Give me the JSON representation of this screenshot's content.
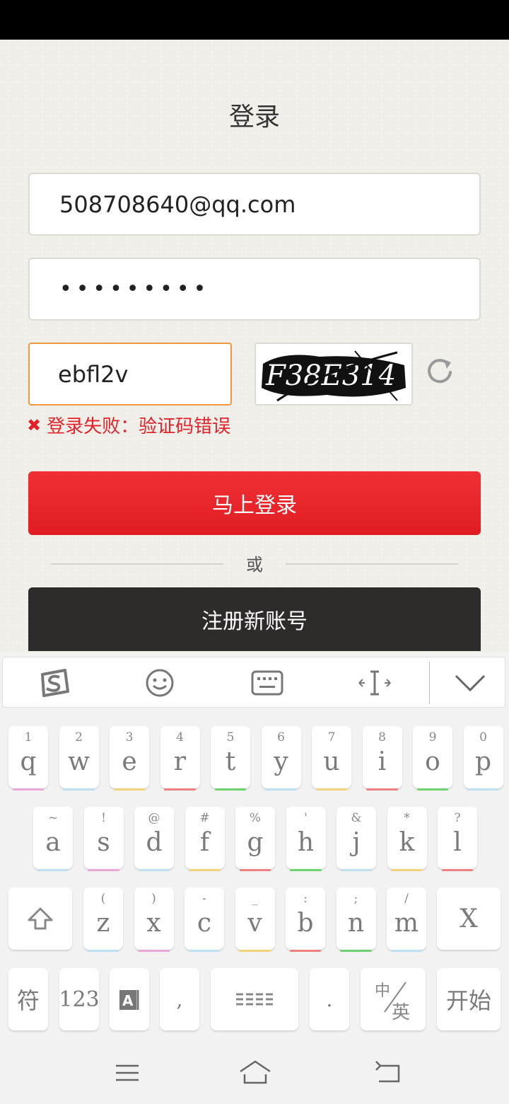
{
  "page": {
    "title": "登录"
  },
  "form": {
    "email_value": "508708640@qq.com",
    "password_value": "•••••••••",
    "captcha_value": "ebfl2v",
    "captcha_image_text": "F38E314",
    "error_text": "登录失败：验证码错误",
    "login_label": "马上登录",
    "or_label": "或",
    "register_label": "注册新账号"
  },
  "keyboard": {
    "row1": [
      {
        "k": "q",
        "s": "1",
        "c": "#e9a7d8"
      },
      {
        "k": "w",
        "s": "2",
        "c": "#bfe0f0"
      },
      {
        "k": "e",
        "s": "3",
        "c": "#f3d27a"
      },
      {
        "k": "r",
        "s": "4",
        "c": "#f07f7f"
      },
      {
        "k": "t",
        "s": "5",
        "c": "#6ed36e"
      },
      {
        "k": "y",
        "s": "6",
        "c": "#bfe0f0"
      },
      {
        "k": "u",
        "s": "7",
        "c": "#f3d27a"
      },
      {
        "k": "i",
        "s": "8",
        "c": "#f07f7f"
      },
      {
        "k": "o",
        "s": "9",
        "c": "#6ed36e"
      },
      {
        "k": "p",
        "s": "0",
        "c": "#bfe0f0"
      }
    ],
    "row2": [
      {
        "k": "a",
        "s": "~",
        "c": "#bfe0f0"
      },
      {
        "k": "s",
        "s": "!",
        "c": "#e9a7d8"
      },
      {
        "k": "d",
        "s": "@",
        "c": "#bfe0f0"
      },
      {
        "k": "f",
        "s": "#",
        "c": "#f3d27a"
      },
      {
        "k": "g",
        "s": "%",
        "c": "#f07f7f"
      },
      {
        "k": "h",
        "s": "'",
        "c": "#6ed36e"
      },
      {
        "k": "j",
        "s": "&",
        "c": "#bfe0f0"
      },
      {
        "k": "k",
        "s": "*",
        "c": "#f3d27a"
      },
      {
        "k": "l",
        "s": "?",
        "c": "#f07f7f"
      }
    ],
    "row3": [
      {
        "k": "z",
        "s": "(",
        "c": "#bfe0f0"
      },
      {
        "k": "x",
        "s": ")",
        "c": "#e9a7d8"
      },
      {
        "k": "c",
        "s": "-",
        "c": "#bfe0f0"
      },
      {
        "k": "v",
        "s": "_",
        "c": "#f3d27a"
      },
      {
        "k": "b",
        "s": ":",
        "c": "#f07f7f"
      },
      {
        "k": "n",
        "s": ";",
        "c": "#6ed36e"
      },
      {
        "k": "m",
        "s": "/",
        "c": "#bfe0f0"
      }
    ],
    "delete_label": "X",
    "symbols_label": "符",
    "numbers_label": "123",
    "comma_label": ",",
    "period_label": ".",
    "lang_top": "中",
    "lang_bottom": "英",
    "enter_label": "开始"
  }
}
